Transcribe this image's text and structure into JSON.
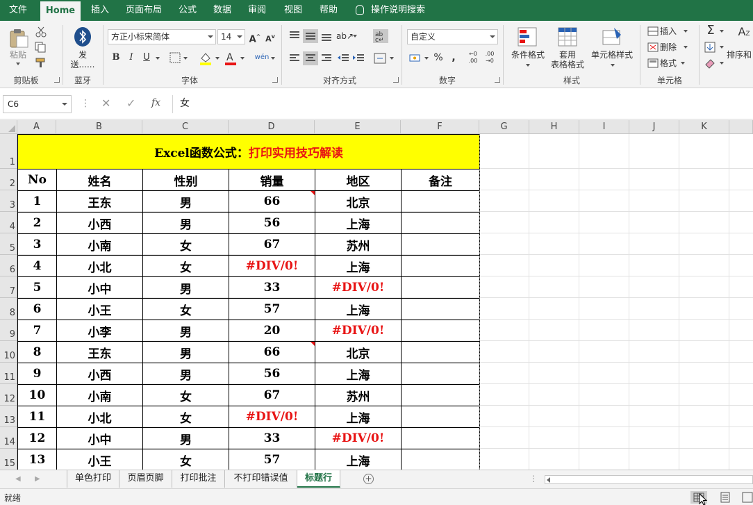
{
  "ribbon_tabs": [
    "文件",
    "Home",
    "插入",
    "页面布局",
    "公式",
    "数据",
    "审阅",
    "视图",
    "帮助"
  ],
  "active_tab": "Home",
  "tell_me": "操作说明搜索",
  "clipboard": {
    "paste": "粘贴",
    "label": "剪贴板"
  },
  "bluetooth": {
    "send": "发送......",
    "label": "蓝牙"
  },
  "font": {
    "name": "方正小标宋简体",
    "size": "14",
    "label": "字体",
    "bold": "B",
    "italic": "I",
    "underline": "U"
  },
  "alignment": {
    "label": "对齐方式"
  },
  "number": {
    "format": "自定义",
    "label": "数字"
  },
  "styles": {
    "conditional": "条件格式",
    "table": "套用\n表格格式",
    "cell": "单元格样式",
    "label": "样式"
  },
  "cells": {
    "insert": "插入",
    "delete": "删除",
    "format": "格式",
    "label": "单元格"
  },
  "editing": {
    "sort": "排序和"
  },
  "formula_bar": {
    "name_box": "C6",
    "content": "女",
    "fx": "fx"
  },
  "columns": [
    "A",
    "B",
    "C",
    "D",
    "E",
    "F",
    "G",
    "H",
    "I",
    "J",
    "K"
  ],
  "rows": [
    "1",
    "2",
    "3",
    "4",
    "5",
    "6",
    "7",
    "8",
    "9",
    "10",
    "11",
    "12",
    "13",
    "14",
    "15"
  ],
  "sheet": {
    "title_black": "Excel函数公式：",
    "title_red": "打印实用技巧解读",
    "headers": [
      "No",
      "姓名",
      "性别",
      "销量",
      "地区",
      "备注"
    ],
    "data": [
      [
        "1",
        "王东",
        "男",
        "66",
        "北京",
        ""
      ],
      [
        "2",
        "小西",
        "男",
        "56",
        "上海",
        ""
      ],
      [
        "3",
        "小南",
        "女",
        "67",
        "苏州",
        ""
      ],
      [
        "4",
        "小北",
        "女",
        "#DIV/0!",
        "上海",
        ""
      ],
      [
        "5",
        "小中",
        "男",
        "33",
        "#DIV/0!",
        ""
      ],
      [
        "6",
        "小王",
        "女",
        "57",
        "上海",
        ""
      ],
      [
        "7",
        "小李",
        "男",
        "20",
        "#DIV/0!",
        ""
      ],
      [
        "8",
        "王东",
        "男",
        "66",
        "北京",
        ""
      ],
      [
        "9",
        "小西",
        "男",
        "56",
        "上海",
        ""
      ],
      [
        "10",
        "小南",
        "女",
        "67",
        "苏州",
        ""
      ],
      [
        "11",
        "小北",
        "女",
        "#DIV/0!",
        "上海",
        ""
      ],
      [
        "12",
        "小中",
        "男",
        "33",
        "#DIV/0!",
        ""
      ],
      [
        "13",
        "小王",
        "女",
        "57",
        "上海",
        ""
      ]
    ],
    "error_color": "#e81414",
    "title_fill": "#ffff00"
  },
  "sheet_tabs": [
    "单色打印",
    "页眉页脚",
    "打印批注",
    "不打印错误值",
    "标题行"
  ],
  "active_sheet": "标题行",
  "status": "就绪",
  "accent": "#217346"
}
